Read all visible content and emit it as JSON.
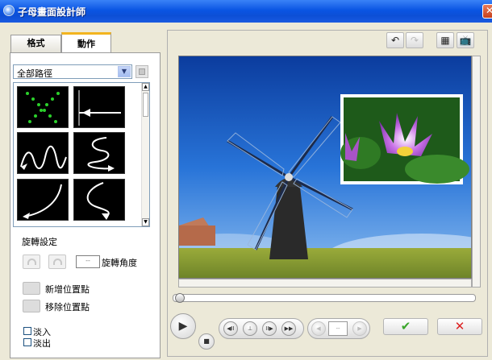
{
  "window": {
    "title": "子母畫面設計師",
    "close_label": "✕"
  },
  "tabs": [
    {
      "label": "格式"
    },
    {
      "label": "動作"
    }
  ],
  "path_select": {
    "value": "全部路徑",
    "arrow": "▼"
  },
  "rotation": {
    "section_label": "旋轉設定",
    "angle_label": "旋轉角度",
    "angle_value": "--"
  },
  "points": {
    "add_label": "新增位置點",
    "remove_label": "移除位置點"
  },
  "options": {
    "fade_in_label": "淡入",
    "fade_out_label": "淡出",
    "fade_in_checked": false,
    "fade_out_checked": false
  },
  "toolbar": {
    "undo_icon": "undo-icon",
    "redo_icon": "redo-icon",
    "grid_icon": "grid-icon",
    "tv_icon": "tv-safe-zone-icon"
  },
  "playback": {
    "play": "▶",
    "stop": "■",
    "prev_frame": "◀II",
    "trim": "⊥",
    "next_frame": "II▶",
    "fast_forward": "▶▶",
    "time_value": "--",
    "prev_point": "◀",
    "next_point": "▶"
  },
  "actions": {
    "ok": "✔",
    "cancel": "✕"
  },
  "colors": {
    "title_bar": "#0a55e3",
    "tab_accent": "#f2b41f",
    "ok": "#3aa62a",
    "cancel": "#dd2222"
  }
}
